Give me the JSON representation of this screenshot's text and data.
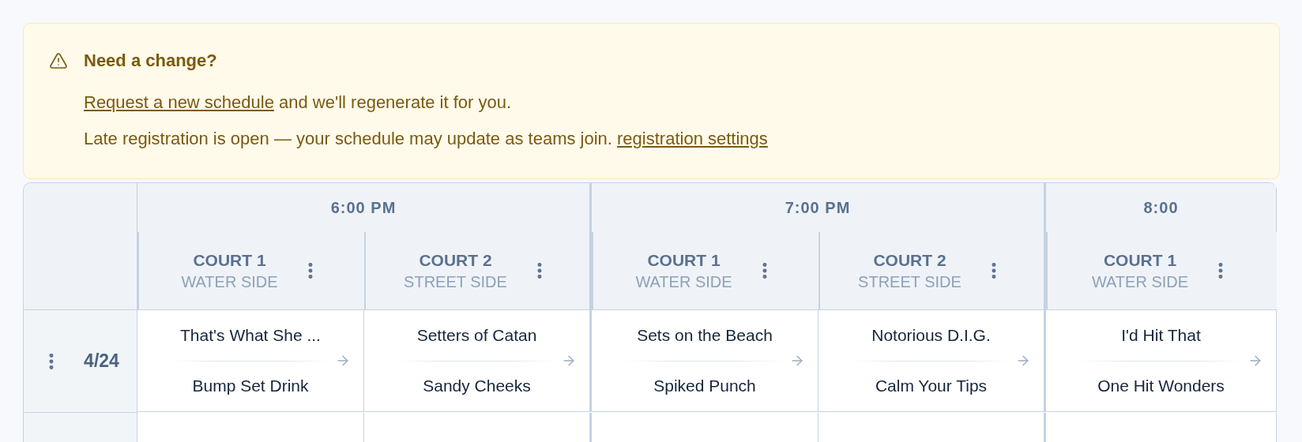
{
  "banner": {
    "title": "Need a change?",
    "lines": [
      [
        {
          "kind": "link",
          "text": "Request a new schedule"
        },
        {
          "kind": "text",
          "text": " and we'll regenerate it for you."
        }
      ],
      [
        {
          "kind": "text",
          "text": "Late registration is open — your schedule may update as teams join. "
        },
        {
          "kind": "link",
          "text": "registration settings"
        }
      ]
    ]
  },
  "schedule": {
    "time_slots": [
      {
        "time": "6:00 PM",
        "courts": [
          {
            "name": "COURT 1",
            "side": "WATER SIDE"
          },
          {
            "name": "COURT 2",
            "side": "STREET SIDE"
          }
        ]
      },
      {
        "time": "7:00 PM",
        "courts": [
          {
            "name": "COURT 1",
            "side": "WATER SIDE"
          },
          {
            "name": "COURT 2",
            "side": "STREET SIDE"
          }
        ]
      },
      {
        "time": "8:00",
        "courts": [
          {
            "name": "COURT 1",
            "side": "WATER SIDE"
          }
        ]
      }
    ],
    "rows": [
      {
        "date": "4/24",
        "matches": [
          {
            "home": "That's What She ...",
            "away": "Bump Set Drink"
          },
          {
            "home": "Setters of Catan",
            "away": "Sandy Cheeks"
          },
          {
            "home": "Sets on the Beach",
            "away": "Spiked Punch"
          },
          {
            "home": "Notorious D.I.G.",
            "away": "Calm Your Tips"
          },
          {
            "home": "I'd Hit That",
            "away": "One Hit Wonders"
          }
        ]
      }
    ]
  }
}
